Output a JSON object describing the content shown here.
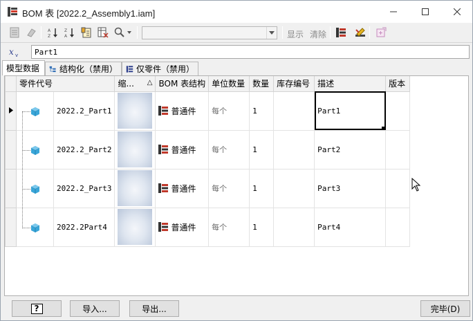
{
  "window": {
    "title": "BOM 表 [2022.2_Assembly1.iam]",
    "minimize_icon": "minimize-icon",
    "maximize_icon": "maximize-icon",
    "close_icon": "close-icon"
  },
  "toolbar": {
    "view_combo_value": "",
    "show_label": "显示",
    "clear_label": "清除"
  },
  "part_number_field": {
    "value": "Part1"
  },
  "tabs": [
    {
      "label": "模型数据",
      "active": true
    },
    {
      "label": "结构化（禁用）",
      "active": false
    },
    {
      "label": "仅零件（禁用）",
      "active": false
    }
  ],
  "grid": {
    "columns": [
      "零件代号",
      "缩...",
      "BOM 表结构",
      "单位数量",
      "数量",
      "库存编号",
      "描述",
      "版本"
    ],
    "sort_indicator": "△",
    "rows": [
      {
        "part_number": "2022.2_Part1",
        "bom_structure": "普通件",
        "unit_qty": "每个",
        "qty": "1",
        "stock_number": "",
        "description": "Part1",
        "revision": "",
        "current": true
      },
      {
        "part_number": "2022.2_Part2",
        "bom_structure": "普通件",
        "unit_qty": "每个",
        "qty": "1",
        "stock_number": "",
        "description": "Part2",
        "revision": "",
        "current": false
      },
      {
        "part_number": "2022.2_Part3",
        "bom_structure": "普通件",
        "unit_qty": "每个",
        "qty": "1",
        "stock_number": "",
        "description": "Part3",
        "revision": "",
        "current": false
      },
      {
        "part_number": "2022.2Part4",
        "bom_structure": "普通件",
        "unit_qty": "每个",
        "qty": "1",
        "stock_number": "",
        "description": "Part4",
        "revision": "",
        "current": false
      }
    ]
  },
  "footer": {
    "help_label": "?",
    "import_label": "导入...",
    "export_label": "导出...",
    "done_label": "完毕(D)"
  },
  "colors": {
    "cube": "#3aa6d8",
    "selection_border": "#000000",
    "header_bg": "#f2f2f2",
    "window_bg": "#f0f0f0"
  }
}
